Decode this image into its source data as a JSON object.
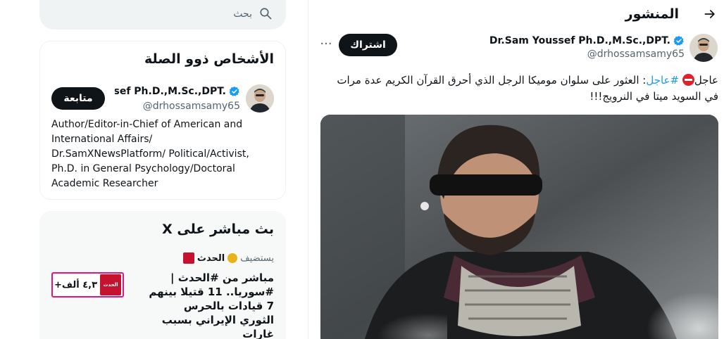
{
  "search": {
    "placeholder": "بحث"
  },
  "header": {
    "title": "المنشور"
  },
  "post": {
    "author_name": "Dr.Sam Youssef Ph.D.,M.Sc.,DPT.",
    "author_handle": "@drhossamsamy65",
    "subscribe_label": "اشتراك",
    "more_label": "···",
    "text_prefix": "عاجل",
    "hashtag": "#عاجل",
    "text_body": ": العثور على سلوان موميكا الرجل الذي أحرق القرآن الكريم عدة مرات في السويد ميتا في النرويج!!!"
  },
  "related": {
    "title": "الأشخاص ذوو الصلة",
    "name": "Dr.Sam Youssef Ph.D.,M.Sc.,DPT.",
    "handle": "@drhossamsamy65",
    "follow_label": "متابعة",
    "bio": "Author/Editor-in-Chief of American and International Affairs/ Dr.SamXNewsPlatform/ Political/Activist, Ph.D. in General Psychology/Doctoral Academic Researcher"
  },
  "live": {
    "title": "بث مباشر على X",
    "host_name": "الحدث",
    "host_role": "يستضيف",
    "space_title": "مباشر من #الحدث | #سوريا.. 11 قتيلا بينهم 7 قيادات بالحرس الثوري الإيراني بسبب غارات",
    "listener_count": "+٤,٣ ألف",
    "logo_text": "الحدث"
  },
  "icons": {
    "back": "back-arrow-icon",
    "search": "search-icon",
    "verified": "verified-badge-icon",
    "no_entry": "no-entry-emoji-icon"
  },
  "colors": {
    "accent": "#1d9bf0",
    "button": "#0f1419",
    "live_border": "#e5137b",
    "host_logo": "#c4122f"
  }
}
